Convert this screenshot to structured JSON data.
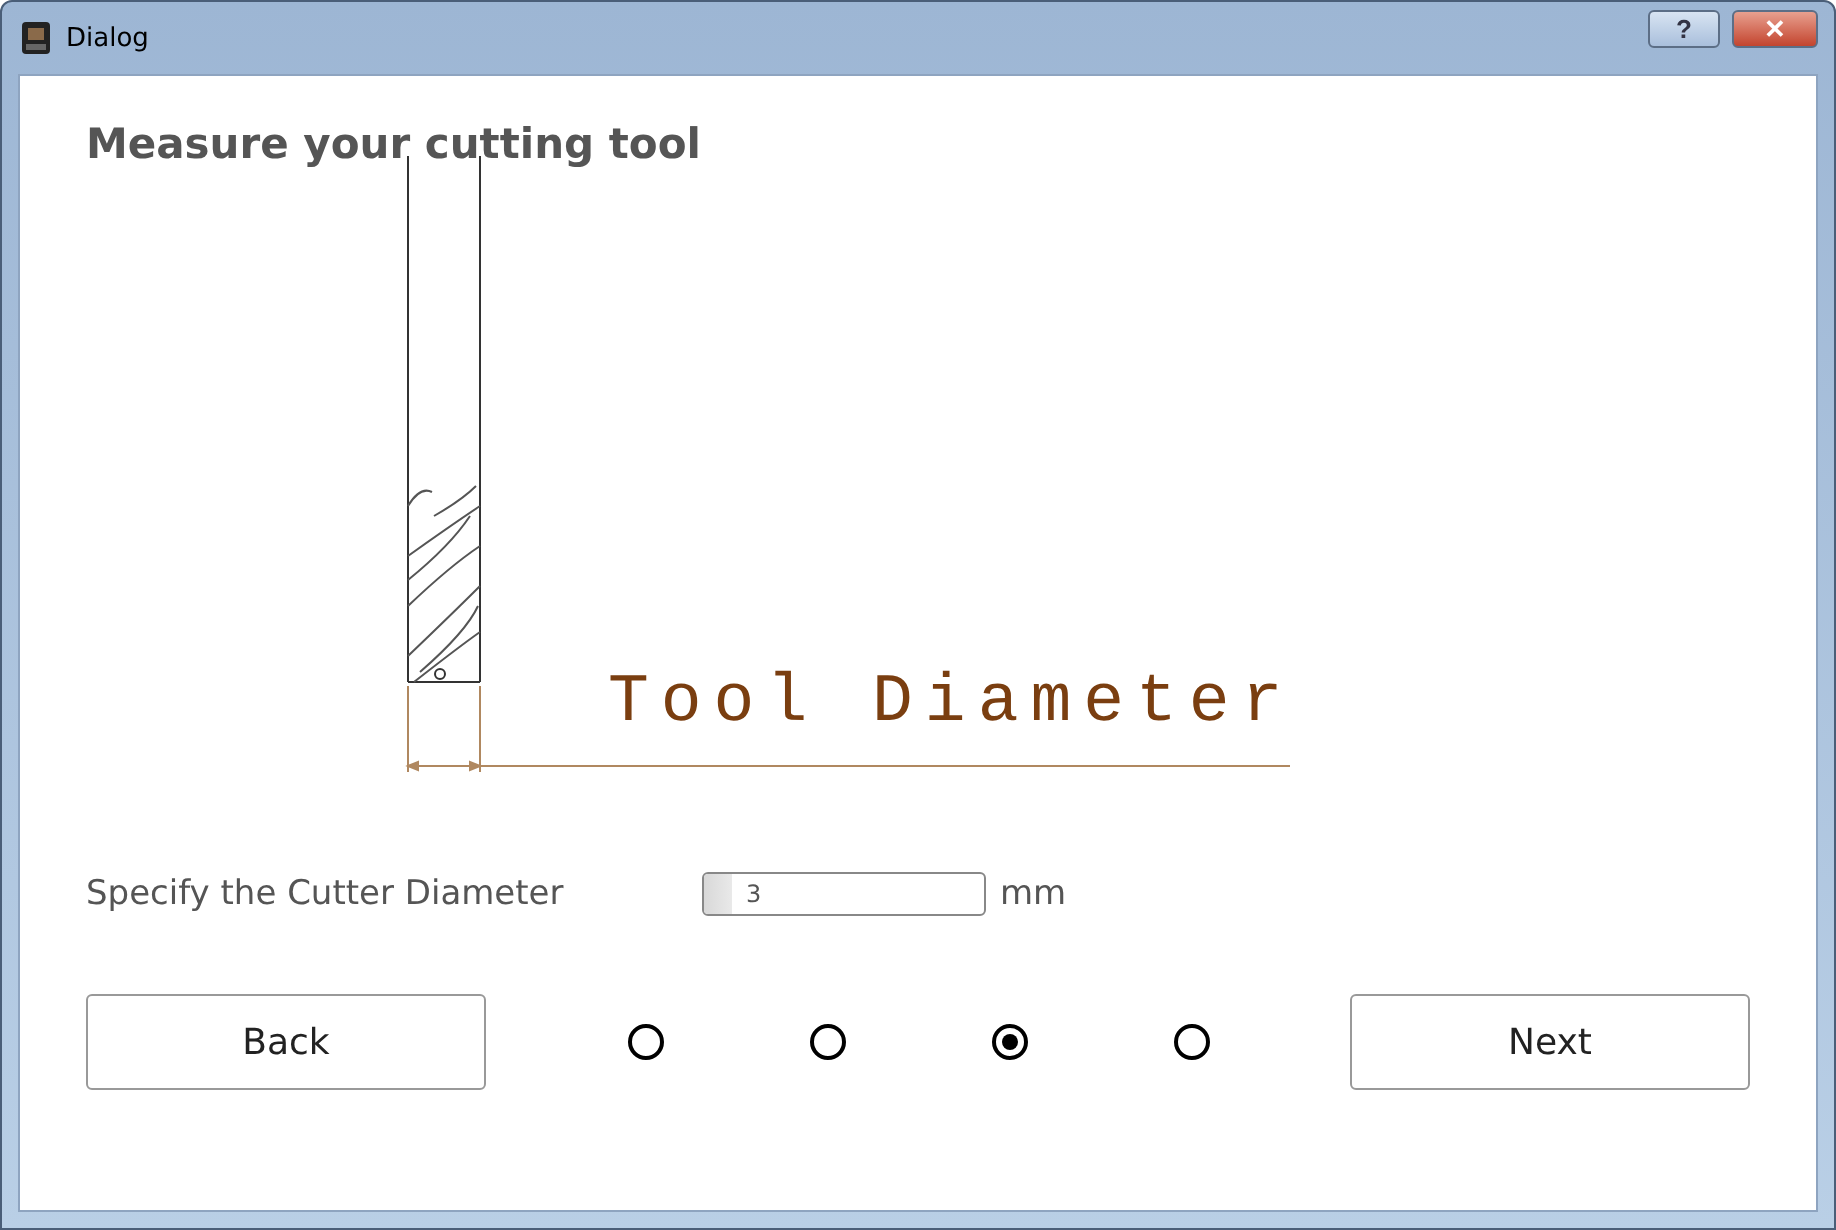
{
  "window": {
    "title": "Dialog",
    "buttons": [
      "?",
      "✕"
    ]
  },
  "heading": "Measure your cutting tool",
  "diagram": {
    "label": "Tool Diameter"
  },
  "field": {
    "label": "Specify the Cutter Diameter",
    "value": "3",
    "unit": "mm"
  },
  "back_button": "Back",
  "steps": [
    {
      "selected": false
    },
    {
      "selected": false
    },
    {
      "selected": true
    },
    {
      "selected": false
    }
  ],
  "next_button": "Next"
}
